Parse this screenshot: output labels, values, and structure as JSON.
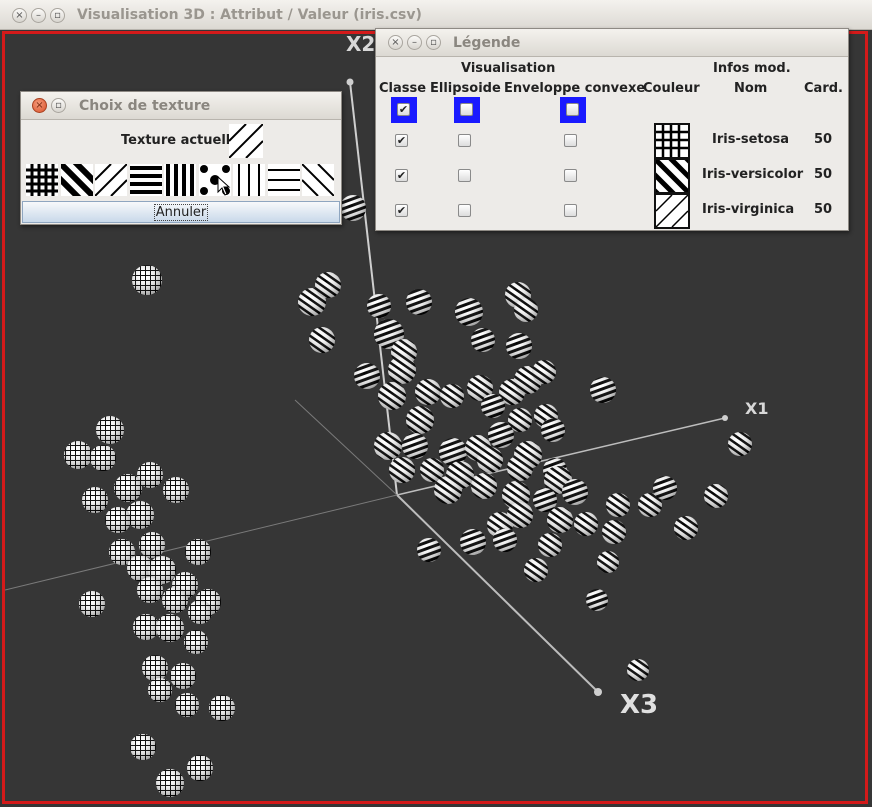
{
  "main_window": {
    "title": "Visualisation 3D : Attribut / Valeur (iris.csv)",
    "axes": {
      "x1": "X1",
      "x2": "X2",
      "x3": "X3"
    }
  },
  "texture_dialog": {
    "title": "Choix de texture",
    "current_label": "Texture actuelle :",
    "current_texture": "diagonal-lines-icon",
    "swatches": [
      "grid-icon",
      "thick-diagonal-icon",
      "thin-diagonal-icon",
      "horizontal-lines-icon",
      "vertical-lines-icon",
      "dots-icon",
      "thin-vertical-icon",
      "thin-horizontal-icon",
      "anti-diagonal-icon"
    ],
    "cancel_label": "Annuler"
  },
  "legend_dialog": {
    "title": "Légende",
    "header_visualisation": "Visualisation",
    "header_infos": "Infos mod.",
    "col_classe": "Classe",
    "col_ellipsoide": "Ellipsoide",
    "col_enveloppe": "Enveloppe convexe",
    "col_couleur": "Couleur",
    "col_nom": "Nom",
    "col_card": "Card.",
    "rows": [
      {
        "name": "Iris-setosa",
        "card": "50",
        "classe": true,
        "ellipsoide": false,
        "enveloppe": false,
        "texture": "grid"
      },
      {
        "name": "Iris-versicolor",
        "card": "50",
        "classe": true,
        "ellipsoide": false,
        "enveloppe": false,
        "texture": "thick-diagonal"
      },
      {
        "name": "Iris-virginica",
        "card": "50",
        "classe": true,
        "ellipsoide": false,
        "enveloppe": false,
        "texture": "diagonal"
      }
    ]
  }
}
